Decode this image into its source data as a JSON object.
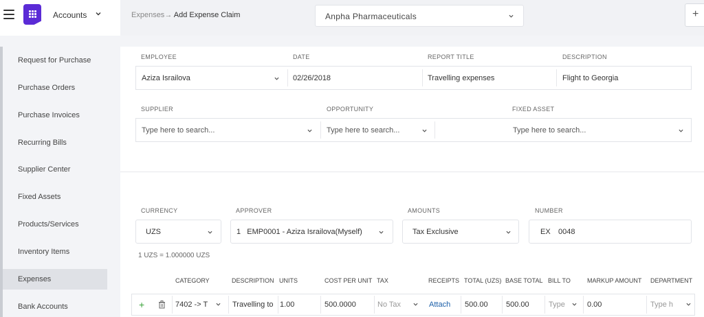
{
  "header": {
    "module": "Accounts",
    "breadcrumb_parent": "Expenses",
    "breadcrumb_arrow": "→",
    "breadcrumb_current": "Add Expense Claim",
    "company": "Anpha Pharmaceuticals",
    "add_label": "+"
  },
  "sidebar": {
    "items": [
      {
        "label": "Request for Purchase"
      },
      {
        "label": "Purchase Orders"
      },
      {
        "label": "Purchase Invoices"
      },
      {
        "label": "Recurring Bills"
      },
      {
        "label": "Supplier Center"
      },
      {
        "label": "Fixed Assets"
      },
      {
        "label": "Products/Services"
      },
      {
        "label": "Inventory Items"
      },
      {
        "label": "Expenses"
      },
      {
        "label": "Bank Accounts"
      }
    ],
    "active_index": 8
  },
  "form": {
    "employee_label": "EMPLOYEE",
    "employee_value": "Aziza Israilova",
    "date_label": "DATE",
    "date_value": "02/26/2018",
    "report_title_label": "REPORT TITLE",
    "report_title_value": "Travelling expenses",
    "description_label": "DESCRIPTION",
    "description_value": "Flight to Georgia",
    "supplier_label": "SUPPLIER",
    "supplier_placeholder": "Type here to search...",
    "opportunity_label": "OPPORTUNITY",
    "opportunity_placeholder": "Type here to search...",
    "fixed_asset_label": "FIXED ASSET",
    "fixed_asset_placeholder": "Type here to search...",
    "currency_label": "CURRENCY",
    "currency_value": "UZS",
    "approver_label": "APPROVER",
    "approver_value": "1   EMP0001 - Aziza Israilova(Myself)",
    "amounts_label": "AMOUNTS",
    "amounts_value": "Tax Exclusive",
    "number_label": "NUMBER",
    "number_prefix": "EX",
    "number_value": "0048",
    "exchange_rate": "1 UZS = 1.000000 UZS"
  },
  "table": {
    "headers": [
      "CATEGORY",
      "DESCRIPTION",
      "UNITS",
      "COST PER UNIT",
      "TAX",
      "RECEIPTS",
      "TOTAL (UZS)",
      "BASE TOTAL",
      "BILL TO",
      "MARKUP AMOUNT",
      "DEPARTMENT"
    ],
    "row": {
      "add_label": "+",
      "category": "7402 -> T",
      "description": "Travelling to",
      "units": "1.00",
      "cost_per_unit": "500.0000",
      "tax": "No Tax",
      "receipts": "Attach",
      "total": "500.00",
      "base_total": "500.00",
      "bill_to": "Type",
      "markup": "0.00",
      "department": "Type h"
    }
  },
  "colors": {
    "brand": "#5b2bd6",
    "link": "#1a5ea8",
    "add": "#3aa23a"
  }
}
